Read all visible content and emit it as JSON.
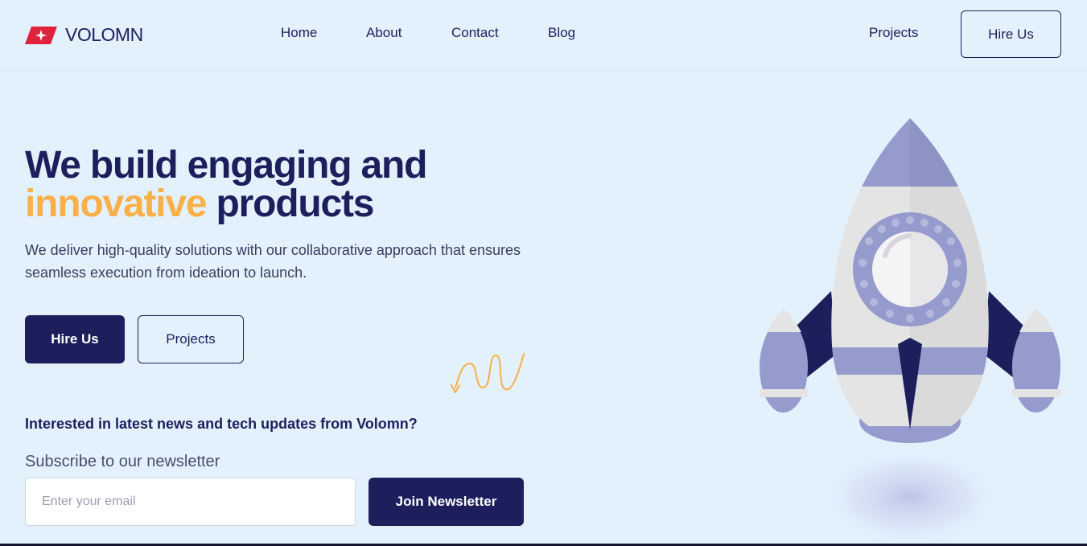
{
  "brand": {
    "name": "VOLOMN",
    "logo_icon": "volomn-logo-icon",
    "logo_color": "#e0233c"
  },
  "nav": {
    "items": [
      {
        "label": "Home"
      },
      {
        "label": "About"
      },
      {
        "label": "Contact"
      },
      {
        "label": "Blog"
      }
    ],
    "projects_label": "Projects",
    "hire_label": "Hire Us"
  },
  "hero": {
    "headline_line1": "We build engaging and",
    "headline_accent": "innovative",
    "headline_end": "products",
    "description": "We deliver high-quality solutions with our collaborative approach that ensures seamless execution from ideation to launch.",
    "primary_cta": "Hire Us",
    "secondary_cta": "Projects"
  },
  "newsletter": {
    "question": "Interested in latest news and tech updates from Volomn?",
    "subtitle": "Subscribe to our newsletter",
    "email_placeholder": "Enter your email",
    "email_value": "",
    "join_label": "Join Newsletter"
  },
  "colors": {
    "primary": "#1c1f5c",
    "accent": "#f9b049",
    "background": "#e3f1fd",
    "rocket_body": "#e4e4e4",
    "rocket_lavender": "#959bcc"
  },
  "illustration": {
    "name": "rocket-illustration",
    "decor_icon": "squiggle-arrow-icon"
  }
}
